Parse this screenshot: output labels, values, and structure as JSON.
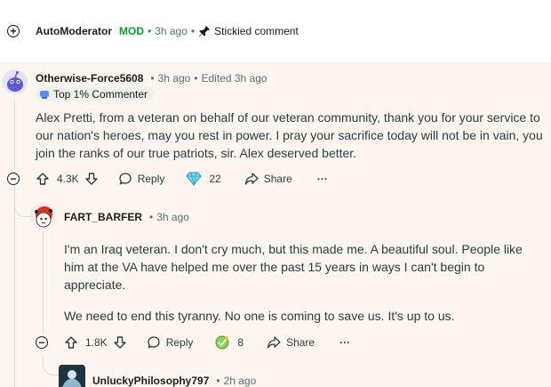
{
  "comments": {
    "automod": {
      "author": "AutoModerator",
      "mod_badge": "MOD",
      "age": "3h ago",
      "sticky": "Stickied comment"
    },
    "first": {
      "author": "Otherwise-Force5608",
      "age": "3h ago",
      "edited": "Edited 3h ago",
      "flair": "Top 1% Commenter",
      "body": "Alex Pretti, from a veteran on behalf of our veteran community, thank you for your service to our nation's heroes, may you rest in power. I pray your sacrifice today will not be in vain, you join the ranks of our true patriots, sir. Alex deserved better.",
      "upvotes": "4.3K",
      "reply_label": "Reply",
      "award_count": "22",
      "share_label": "Share",
      "more_label": "···"
    },
    "second": {
      "author": "FART_BARFER",
      "age": "3h ago",
      "body_p1": "I'm an Iraq veteran. I don't cry much, but this made me. A beautiful soul. People like him at the VA have helped me over the past 15 years in ways I can't begin to appreciate.",
      "body_p2": "We need to end this tyranny. No one is coming to save us. It's up to us.",
      "upvotes": "1.8K",
      "reply_label": "Reply",
      "award_count": "8",
      "share_label": "Share",
      "more_label": "···"
    },
    "third": {
      "author": "UnluckyPhilosophy797",
      "age": "2h ago"
    }
  },
  "icons": {
    "expand": "plus-circle-icon",
    "collapse": "minus-circle-icon",
    "pin": "pin-icon",
    "upvote": "arrow-up-icon",
    "downvote": "arrow-down-icon",
    "reply": "speech-bubble-icon",
    "share": "share-arrow-icon",
    "award_blue": "diamond-award-icon",
    "award_green": "green-award-icon"
  },
  "colors": {
    "mod_green": "#0f9a3a",
    "highlight_bg": "#fdf6ee",
    "meta_gray": "#576f76"
  }
}
